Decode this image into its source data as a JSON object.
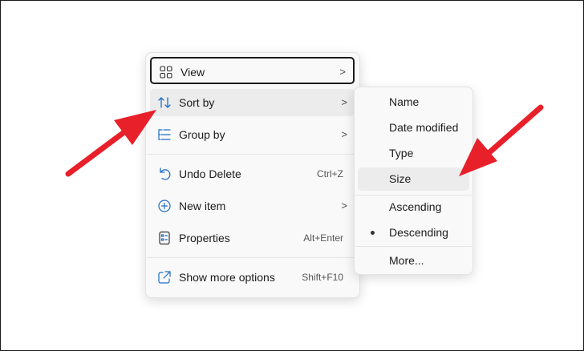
{
  "menu": {
    "items": [
      {
        "label": "View",
        "icon": "grid-icon",
        "has_submenu": true
      },
      {
        "label": "Sort by",
        "icon": "sort-arrows-icon",
        "has_submenu": true
      },
      {
        "label": "Group by",
        "icon": "group-list-icon",
        "has_submenu": true
      },
      {
        "label": "Undo Delete",
        "icon": "undo-icon",
        "shortcut": "Ctrl+Z"
      },
      {
        "label": "New item",
        "icon": "add-circle-icon",
        "has_submenu": true
      },
      {
        "label": "Properties",
        "icon": "properties-icon",
        "shortcut": "Alt+Enter"
      },
      {
        "label": "Show more options",
        "icon": "share-external-icon",
        "shortcut": "Shift+F10"
      }
    ],
    "chevron": ">"
  },
  "submenu": {
    "items": [
      {
        "label": "Name"
      },
      {
        "label": "Date modified"
      },
      {
        "label": "Type"
      },
      {
        "label": "Size"
      },
      {
        "label": "Ascending"
      },
      {
        "label": "Descending",
        "selected": true
      },
      {
        "label": "More..."
      }
    ]
  },
  "colors": {
    "annotation_arrow": "#e8202a",
    "menu_background": "#f9f9f9",
    "hover_background": "#ececec",
    "icon_blue": "#1f6fc4"
  }
}
